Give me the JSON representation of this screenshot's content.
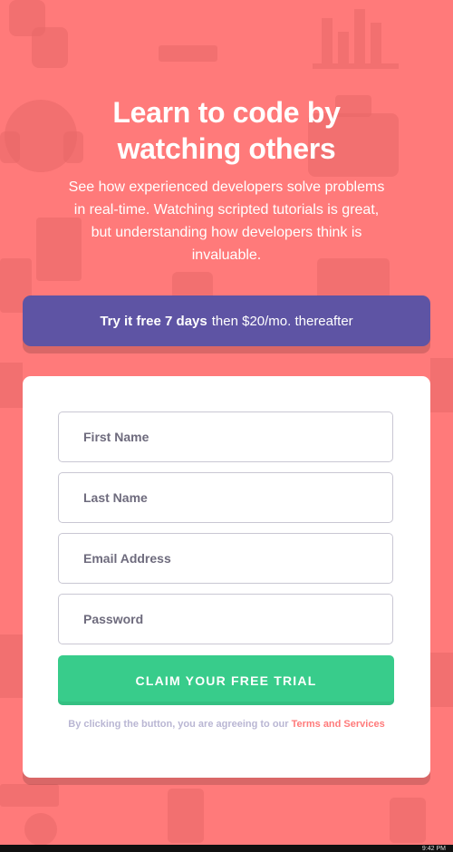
{
  "hero": {
    "headline_line1": "Learn to code by",
    "headline_line2": "watching others",
    "intro": "See how experienced developers solve problems in real-time. Watching scripted tutorials is great, but understanding how developers think is invaluable."
  },
  "offer": {
    "strong": "Try it free 7 days",
    "rest": "then $20/mo. thereafter"
  },
  "form": {
    "first_name_placeholder": "First Name",
    "last_name_placeholder": "Last Name",
    "email_placeholder": "Email Address",
    "password_placeholder": "Password",
    "submit_label": "CLAIM YOUR FREE TRIAL",
    "terms_prefix": "By clicking the button, you are agreeing to our",
    "terms_link": "Terms and Services"
  },
  "colors": {
    "background": "#ff7a7a",
    "banner": "#5e54a4",
    "button": "#38cc8b",
    "terms_link": "#ff7a7a"
  },
  "taskbar": {
    "clock": "9:42 PM"
  }
}
